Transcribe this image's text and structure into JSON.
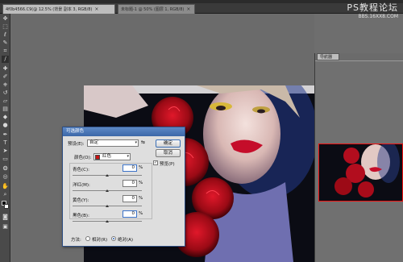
{
  "tabs": [
    {
      "label": "4f0b4566.C9(@ 12.5% (背景 副本 3, RGB/8)",
      "active": true
    },
    {
      "label": "未标题-1 @ 50% (图层 1, RGB/8)",
      "active": false
    }
  ],
  "watermark": {
    "title": "PS教程论坛",
    "subtitle": "BBS.16XX8.COM"
  },
  "navigator": {
    "tab": "导航器"
  },
  "dialog": {
    "title": "可选颜色",
    "preset_label": "预设(E):",
    "preset_value": "自定",
    "colors_label": "颜色(O):",
    "colors_value": "红色",
    "colors_swatch": "#cc1111",
    "sliders": [
      {
        "label": "青色(C):",
        "value": "0",
        "pct": "%",
        "position": 0.5
      },
      {
        "label": "洋红(M):",
        "value": "0",
        "pct": "%",
        "position": 0.5
      },
      {
        "label": "黄色(Y):",
        "value": "0",
        "pct": "%",
        "position": 0.5
      },
      {
        "label": "黑色(B):",
        "value": "0",
        "pct": "%",
        "position": 0.5
      }
    ],
    "ok": "确定",
    "cancel": "取消",
    "preview": "预览(P)",
    "preview_checked": true,
    "method_label": "方法:",
    "method_relative": "相对(R)",
    "method_absolute": "绝对(A)",
    "method_selected": "absolute"
  },
  "colors": {
    "accent": "#3b67a8",
    "thumb_border": "#ee1111"
  }
}
